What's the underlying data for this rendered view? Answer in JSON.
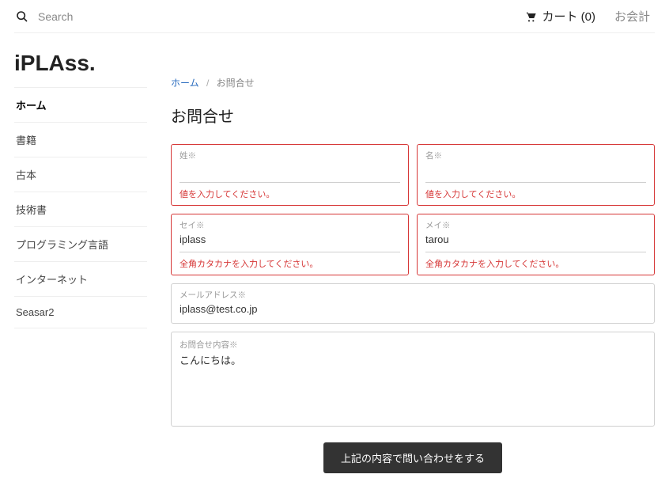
{
  "topbar": {
    "search_placeholder": "Search",
    "cart_label": "カート (0)",
    "checkout_label": "お会計"
  },
  "brand": "iPLAss.",
  "sidebar": {
    "items": [
      {
        "label": "ホーム",
        "active": true
      },
      {
        "label": "書籍"
      },
      {
        "label": "古本"
      },
      {
        "label": "技術書"
      },
      {
        "label": "プログラミング言語"
      },
      {
        "label": "インターネット"
      },
      {
        "label": "Seasar2"
      }
    ]
  },
  "breadcrumb": {
    "home": "ホーム",
    "sep": "/",
    "current": "お問合せ"
  },
  "page_title": "お問合せ",
  "form": {
    "last_name": {
      "label": "姓※",
      "value": "",
      "error": "値を入力してください。"
    },
    "first_name": {
      "label": "名※",
      "value": "",
      "error": "値を入力してください。"
    },
    "last_kana": {
      "label": "セイ※",
      "value": "iplass",
      "error": "全角カタカナを入力してください。"
    },
    "first_kana": {
      "label": "メイ※",
      "value": "tarou",
      "error": "全角カタカナを入力してください。"
    },
    "email": {
      "label": "メールアドレス※",
      "value": "iplass@test.co.jp"
    },
    "content": {
      "label": "お問合せ内容※",
      "value": "こんにちは。"
    },
    "submit_label": "上記の内容で問い合わせをする"
  }
}
